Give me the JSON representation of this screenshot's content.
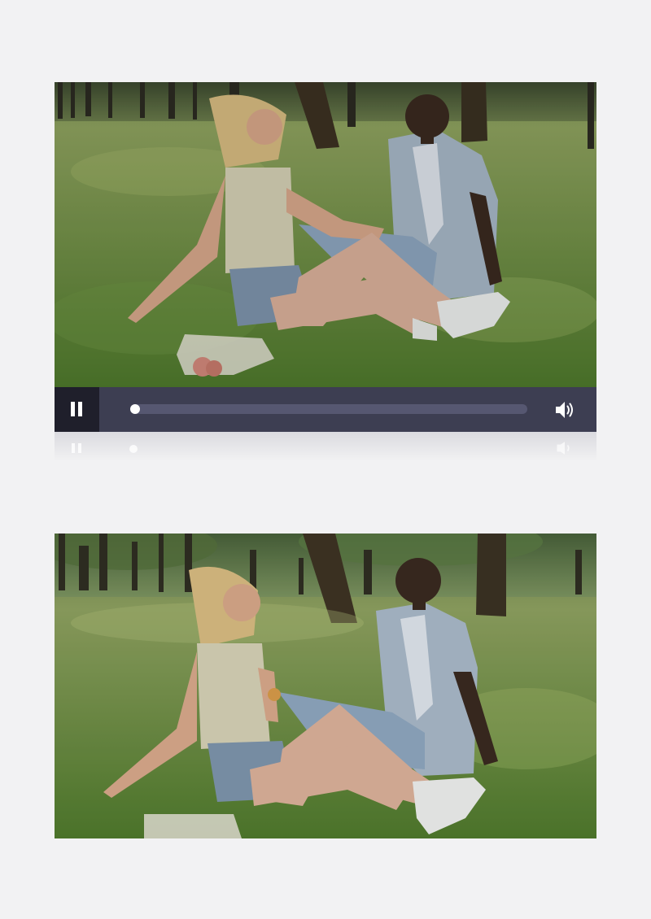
{
  "player": {
    "state": "playing",
    "progress": 0.0,
    "controls": {
      "play_pause_icon": "pause-icon",
      "volume_icon": "volume-icon"
    }
  },
  "frames": {
    "first": {
      "icon": "video-frame"
    },
    "second": {
      "icon": "video-frame"
    }
  },
  "colors": {
    "page_background": "#f2f2f3",
    "control_bar": "#3d3e52",
    "play_button": "#1f1f2b",
    "progress_track": "#565771"
  }
}
